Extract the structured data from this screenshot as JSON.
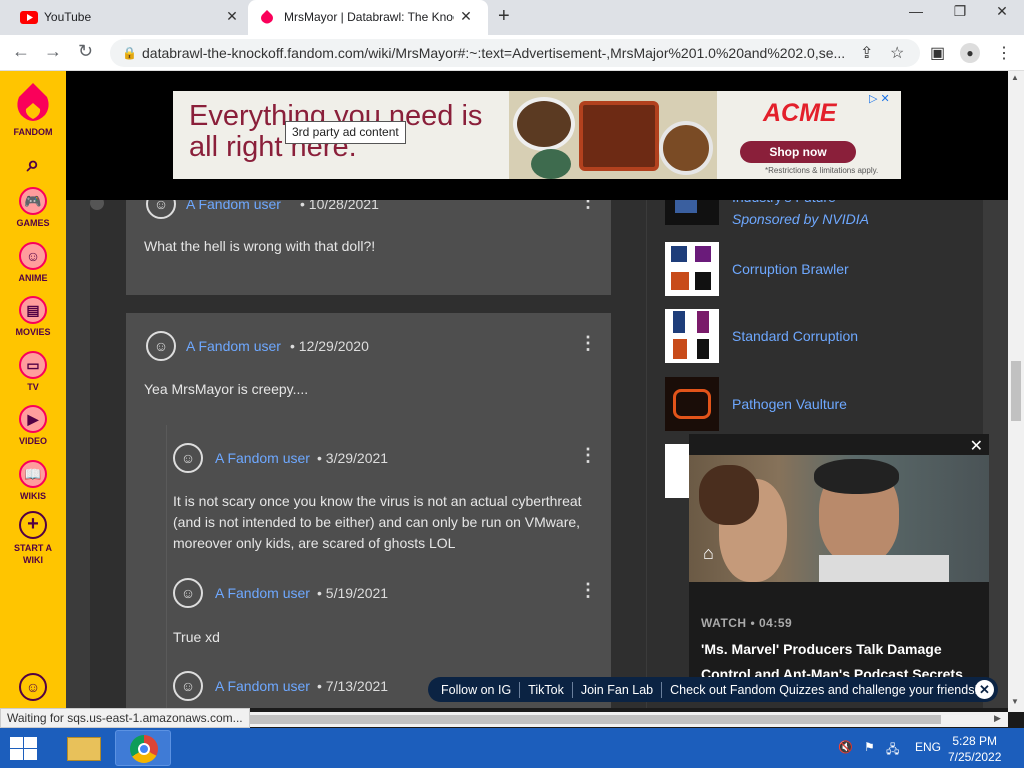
{
  "browser": {
    "tabs": [
      {
        "title": "YouTube",
        "icon": "youtube-icon"
      },
      {
        "title": "MrsMayor | Databrawl: The Knoc",
        "icon": "fandom-icon"
      }
    ],
    "url": "databrawl-the-knockoff.fandom.com/wiki/MrsMayor#:~:text=Advertisement-,MrsMajor%201.0%20and%202.0,se..."
  },
  "rail": {
    "logo_label": "FANDOM",
    "items": [
      "GAMES",
      "ANIME",
      "MOVIES",
      "TV",
      "VIDEO",
      "WIKIS",
      "START A WIKI"
    ]
  },
  "ad": {
    "headline": "Everything you need is all right here.",
    "brand": "ACME",
    "cta": "Shop now",
    "restrictions": "*Restrictions & limitations apply.",
    "tooltip": "3rd party ad content"
  },
  "comments": [
    {
      "user": "A Fandom user",
      "date": "10/28/2021",
      "text": "What the hell is wrong with that doll?!"
    },
    {
      "user": "A Fandom user",
      "date": "12/29/2020",
      "text": "Yea MrsMayor is creepy...."
    },
    {
      "user": "A Fandom user",
      "date": "3/29/2021",
      "text": "It is not scary once you know the virus is not an actual cyberthreat (and is not intended to be either) and can only be run on VMware, moreover only kids, are scared of ghosts LOL"
    },
    {
      "user": "A Fandom user",
      "date": "5/19/2021",
      "text": "True xd"
    },
    {
      "user": "A Fandom user",
      "date": "7/13/2021",
      "text": ""
    }
  ],
  "sidebar": {
    "sponsored_title": "Industry's Future",
    "sponsored_by": "Sponsored by NVIDIA",
    "links": [
      "Corruption Brawler",
      "Standard Corruption",
      "Pathogen Vaulture"
    ]
  },
  "video": {
    "watch_label": "WATCH",
    "duration": "04:59",
    "title": "'Ms. Marvel' Producers Talk Damage Control and Ant-Man's Podcast Secrets"
  },
  "social_bar": {
    "items": [
      "Follow on IG",
      "TikTok",
      "Join Fan Lab",
      "Check out Fandom Quizzes and challenge your friends!"
    ]
  },
  "status_text": "Waiting for sqs.us-east-1.amazonaws.com...",
  "taskbar": {
    "lang": "ENG",
    "time": "5:28 PM",
    "date": "7/25/2022"
  },
  "colors": {
    "fandom_yellow": "#ffc500",
    "fandom_pink": "#fa005a",
    "link_blue": "#6ea8ff",
    "taskbar_blue": "#1c5ebc"
  }
}
